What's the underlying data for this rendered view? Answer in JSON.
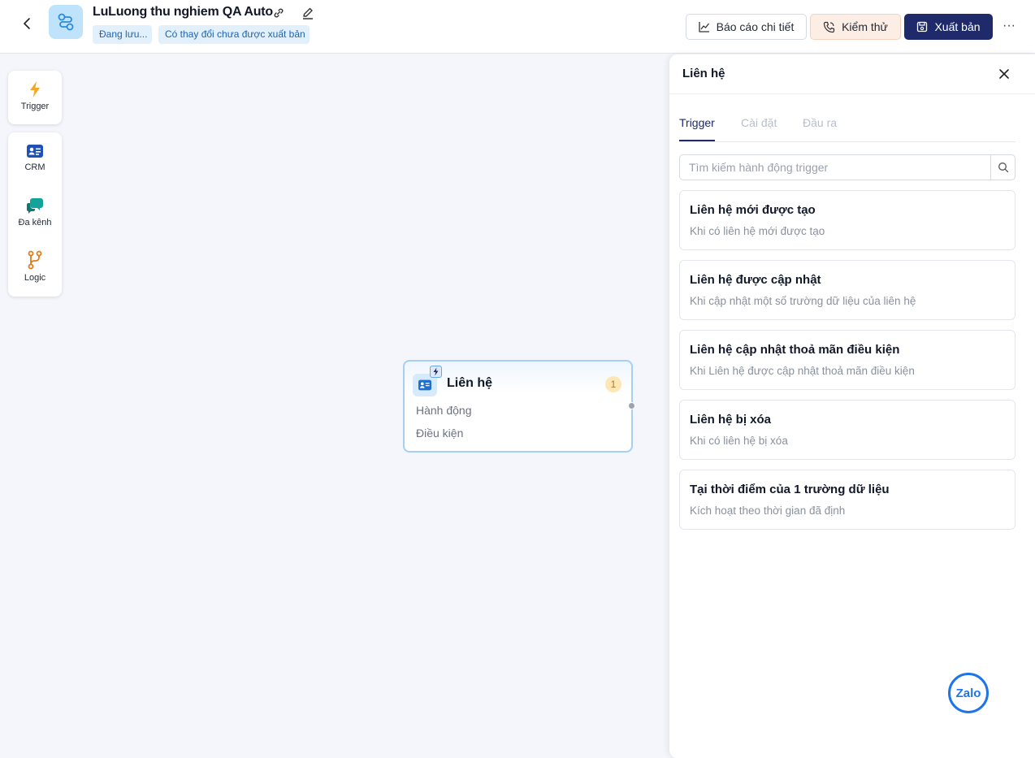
{
  "header": {
    "title": "LuLuong thu nghiem QA Auto",
    "badge_saving": "Đang lưu...",
    "badge_unpublished": "Có thay đổi chưa được xuất bản",
    "report_label": "Báo cáo chi tiết",
    "test_label": "Kiểm thử",
    "publish_label": "Xuất bản",
    "more_label": "···"
  },
  "toolbar": {
    "trigger": "Trigger",
    "items": [
      {
        "label": "CRM",
        "icon": "contact-card-icon"
      },
      {
        "label": "Đa kênh",
        "icon": "chat-bubbles-icon"
      },
      {
        "label": "Logic",
        "icon": "branch-icon"
      }
    ]
  },
  "node": {
    "title": "Liên hệ",
    "count": "1",
    "action": "Hành động",
    "condition": "Điều kiện"
  },
  "panel": {
    "title": "Liên hệ",
    "tabs": [
      "Trigger",
      "Cài đặt",
      "Đầu ra"
    ],
    "active_tab": "Trigger",
    "search_placeholder": "Tìm kiếm hành động trigger",
    "cards": [
      {
        "title": "Liên hệ mới được tạo",
        "desc": "Khi có liên hệ mới được tạo"
      },
      {
        "title": "Liên hệ được cập nhật",
        "desc": "Khi cập nhật một số trường dữ liệu của liên hệ"
      },
      {
        "title": "Liên hệ cập nhật thoả mãn điều kiện",
        "desc": "Khi Liên hệ được cập nhật thoả mãn điều kiện"
      },
      {
        "title": "Liên hệ bị xóa",
        "desc": "Khi có liên hệ bị xóa"
      },
      {
        "title": "Tại thời điểm của 1 trường dữ liệu",
        "desc": "Kích hoạt theo thời gian đã định"
      }
    ]
  },
  "zalo": {
    "label": "Zalo"
  },
  "colors": {
    "primary": "#1f2a6b",
    "badge_bg": "#e2f0fc",
    "canvas_bg": "#f4f6fb",
    "test_bg": "#fdeee5"
  }
}
